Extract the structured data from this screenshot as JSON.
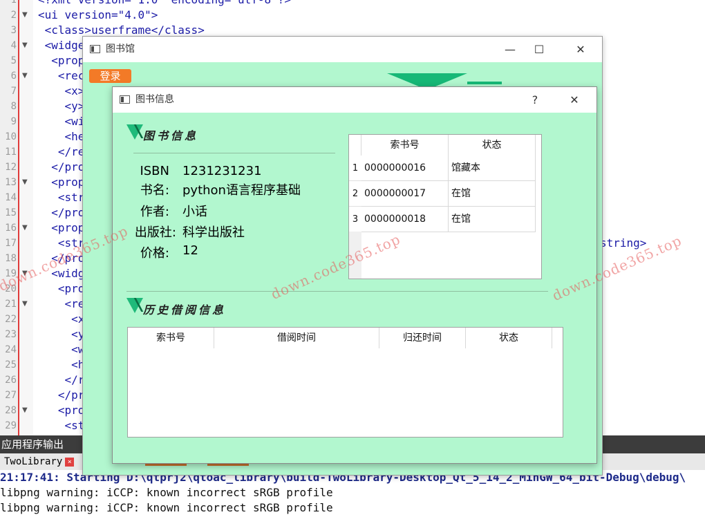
{
  "editor": {
    "lines": [
      {
        "n": "1",
        "fold": "",
        "text": "<?xml version=\"1.0\" encoding=\"utf-8\"?>"
      },
      {
        "n": "2",
        "fold": "▼",
        "text": "<ui version=\"4.0\">"
      },
      {
        "n": "3",
        "fold": "",
        "text": " <class>userframe</class>"
      },
      {
        "n": "4",
        "fold": "▼",
        "text": " <widge"
      },
      {
        "n": "5",
        "fold": "",
        "text": "  <prop"
      },
      {
        "n": "6",
        "fold": "▼",
        "text": "   <rec"
      },
      {
        "n": "7",
        "fold": "",
        "text": "    <x>"
      },
      {
        "n": "8",
        "fold": "",
        "text": "    <y>"
      },
      {
        "n": "9",
        "fold": "",
        "text": "    <wi"
      },
      {
        "n": "10",
        "fold": "",
        "text": "    <he"
      },
      {
        "n": "11",
        "fold": "",
        "text": "   </re"
      },
      {
        "n": "12",
        "fold": "",
        "text": "  </pro"
      },
      {
        "n": "13",
        "fold": "▼",
        "text": "  <prop"
      },
      {
        "n": "14",
        "fold": "",
        "text": "   <str"
      },
      {
        "n": "15",
        "fold": "",
        "text": "  </pro"
      },
      {
        "n": "16",
        "fold": "▼",
        "text": "  <prop"
      },
      {
        "n": "17",
        "fold": "",
        "text": "   <str"
      },
      {
        "n": "18",
        "fold": "",
        "text": "  </pro"
      },
      {
        "n": "19",
        "fold": "▼",
        "text": "  <widg"
      },
      {
        "n": "20",
        "fold": "",
        "text": "   <pro"
      },
      {
        "n": "21",
        "fold": "▼",
        "text": "    <re"
      },
      {
        "n": "22",
        "fold": "",
        "text": "     <x"
      },
      {
        "n": "23",
        "fold": "",
        "text": "     <y"
      },
      {
        "n": "24",
        "fold": "",
        "text": "     <w"
      },
      {
        "n": "25",
        "fold": "",
        "text": "     <h"
      },
      {
        "n": "26",
        "fold": "",
        "text": "    </r"
      },
      {
        "n": "27",
        "fold": "",
        "text": "   </pr"
      },
      {
        "n": "28",
        "fold": "▼",
        "text": "   <pro"
      },
      {
        "n": "29",
        "fold": "",
        "text": "    <st"
      }
    ],
    "right_fragment": "string>"
  },
  "output": {
    "header": "应用程序输出",
    "tab_label": "TwoLibrary",
    "tab_close": "×",
    "lines": [
      {
        "text": "21:17:41: Starting D:\\qtprj2\\qtoac_library\\build-TwoLibrary-Desktop_Qt_5_14_2_MinGW_64_bit-Debug\\debug\\",
        "bold": true
      },
      {
        "text": "libpng warning: iCCP: known incorrect sRGB profile",
        "bold": false
      },
      {
        "text": "libpng warning: iCCP: known incorrect sRGB profile",
        "bold": false
      }
    ]
  },
  "main_window": {
    "title": "图书馆",
    "minimize": "—",
    "maximize": "☐",
    "close": "✕",
    "login_label": "登录"
  },
  "dialog": {
    "title": "图书信息",
    "help": "?",
    "close": "✕",
    "book_section_title": "图书信息",
    "history_section_title": "历史借阅信息",
    "info": {
      "isbn_label": "ISBN",
      "isbn_value": "1231231231",
      "name_label": "书名:",
      "name_value": "python语言程序基础",
      "author_label": "作者:",
      "author_value": "小话",
      "publisher_label": "出版社:",
      "publisher_value": "科学出版社",
      "price_label": "价格:",
      "price_value": "12"
    },
    "copies_table": {
      "headers": [
        "索书号",
        "状态"
      ],
      "rows": [
        {
          "idx": "1",
          "call_no": "0000000016",
          "status": "馆藏本"
        },
        {
          "idx": "2",
          "call_no": "0000000017",
          "status": "在馆"
        },
        {
          "idx": "3",
          "call_no": "0000000018",
          "status": "在馆"
        }
      ]
    },
    "history_table": {
      "headers": [
        "索书号",
        "借阅时间",
        "归还时间",
        "状态"
      ]
    }
  },
  "watermark": {
    "text": "down.code365.top"
  },
  "colors": {
    "dialog_bg": "#b2f7cf",
    "accent_green": "#1fba7a",
    "login_orange": "#f37a27",
    "output_header": "#3c3c3c"
  }
}
